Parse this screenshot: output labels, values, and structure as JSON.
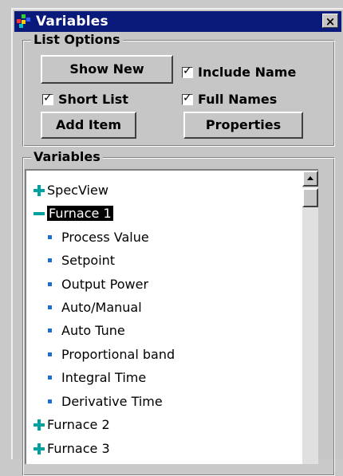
{
  "window": {
    "title": "Variables",
    "close_label": "×"
  },
  "list_options": {
    "legend": "List Options",
    "show_new_label": "Show New",
    "include_name_label": "Include Name",
    "include_name_checked": true,
    "short_list_label": "Short List",
    "short_list_checked": true,
    "full_names_label": "Full Names",
    "full_names_checked": true,
    "add_item_label": "Add Item",
    "properties_label": "Properties"
  },
  "variables": {
    "legend": "Variables",
    "items": [
      {
        "label": "SpecView",
        "type": "collapsed"
      },
      {
        "label": "Furnace 1",
        "type": "expanded",
        "selected": true
      },
      {
        "label": "Process Value",
        "type": "child"
      },
      {
        "label": "Setpoint",
        "type": "child"
      },
      {
        "label": "Output Power",
        "type": "child"
      },
      {
        "label": "Auto/Manual",
        "type": "child"
      },
      {
        "label": "Auto Tune",
        "type": "child"
      },
      {
        "label": "Proportional band",
        "type": "child"
      },
      {
        "label": "Integral Time",
        "type": "child"
      },
      {
        "label": "Derivative Time",
        "type": "child"
      },
      {
        "label": "Furnace 2",
        "type": "collapsed"
      },
      {
        "label": "Furnace 3",
        "type": "collapsed"
      }
    ]
  },
  "colors": {
    "titlebar": "#0a1a7a",
    "tree_icon": "#00a0a0",
    "bullet": "#1a6fd0"
  }
}
